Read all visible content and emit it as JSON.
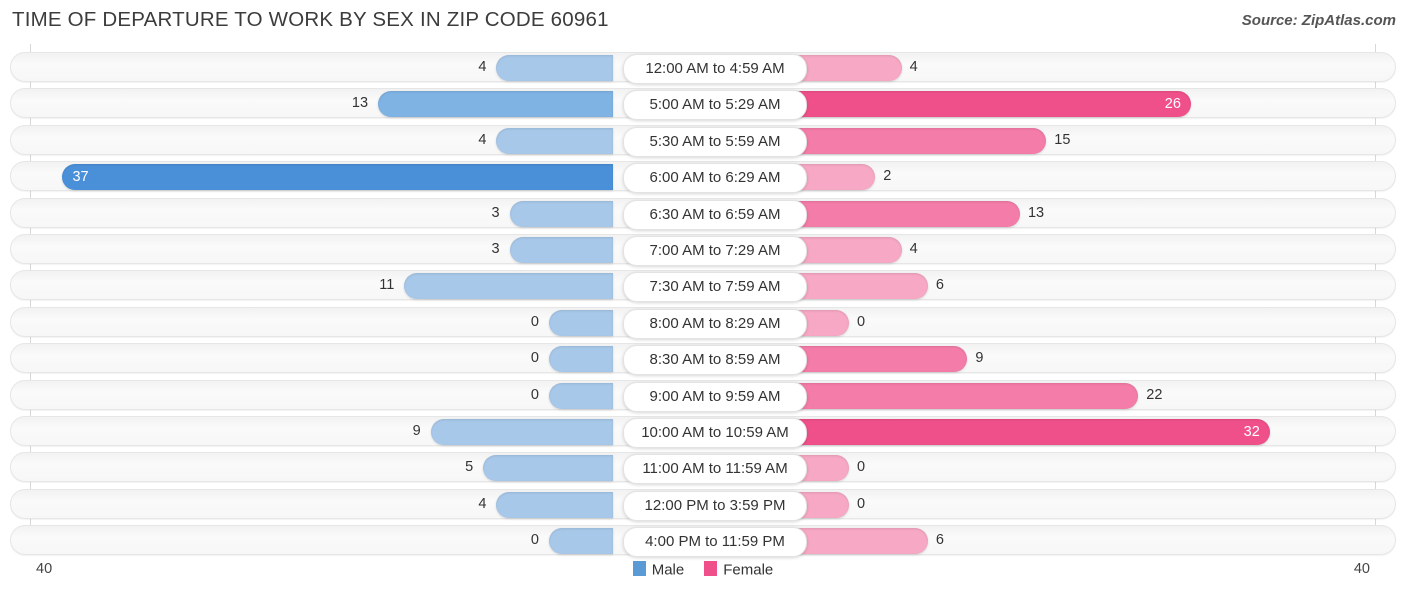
{
  "header": {
    "title": "TIME OF DEPARTURE TO WORK BY SEX IN ZIP CODE 60961",
    "source": "Source: ZipAtlas.com"
  },
  "legend": {
    "items": [
      {
        "label": "Male",
        "color": "#5b9bd5"
      },
      {
        "label": "Female",
        "color": "#f0508a"
      }
    ]
  },
  "axis": {
    "left_end_label": "40",
    "right_end_label": "40",
    "max": 40
  },
  "colors": {
    "male_dark": "#4a90d9",
    "male_mid": "#7fb3e3",
    "male_light": "#a8c8ea",
    "female_dark": "#f0508a",
    "female_mid": "#f47ca8",
    "female_light": "#f7a8c4",
    "row_background": "#f7f7f7",
    "text": "#333333"
  },
  "chart_data": {
    "type": "bar",
    "orientation": "horizontal-diverging",
    "title": "TIME OF DEPARTURE TO WORK BY SEX IN ZIP CODE 60961",
    "xlabel": "",
    "ylabel": "",
    "xlim": [
      40,
      40
    ],
    "grid": false,
    "legend_position": "bottom-center",
    "categories": [
      "12:00 AM to 4:59 AM",
      "5:00 AM to 5:29 AM",
      "5:30 AM to 5:59 AM",
      "6:00 AM to 6:29 AM",
      "6:30 AM to 6:59 AM",
      "7:00 AM to 7:29 AM",
      "7:30 AM to 7:59 AM",
      "8:00 AM to 8:29 AM",
      "8:30 AM to 8:59 AM",
      "9:00 AM to 9:59 AM",
      "10:00 AM to 10:59 AM",
      "11:00 AM to 11:59 AM",
      "12:00 PM to 3:59 PM",
      "4:00 PM to 11:59 PM"
    ],
    "series": [
      {
        "name": "Male",
        "values": [
          4,
          13,
          4,
          37,
          3,
          3,
          11,
          0,
          0,
          0,
          9,
          5,
          4,
          0
        ]
      },
      {
        "name": "Female",
        "values": [
          4,
          26,
          15,
          2,
          13,
          4,
          6,
          0,
          9,
          22,
          32,
          0,
          0,
          6
        ]
      }
    ]
  },
  "rows": [
    {
      "label": "12:00 AM to 4:59 AM",
      "male": "4",
      "female": "4"
    },
    {
      "label": "5:00 AM to 5:29 AM",
      "male": "13",
      "female": "26"
    },
    {
      "label": "5:30 AM to 5:59 AM",
      "male": "4",
      "female": "15"
    },
    {
      "label": "6:00 AM to 6:29 AM",
      "male": "37",
      "female": "2"
    },
    {
      "label": "6:30 AM to 6:59 AM",
      "male": "3",
      "female": "13"
    },
    {
      "label": "7:00 AM to 7:29 AM",
      "male": "3",
      "female": "4"
    },
    {
      "label": "7:30 AM to 7:59 AM",
      "male": "11",
      "female": "6"
    },
    {
      "label": "8:00 AM to 8:29 AM",
      "male": "0",
      "female": "0"
    },
    {
      "label": "8:30 AM to 8:59 AM",
      "male": "0",
      "female": "9"
    },
    {
      "label": "9:00 AM to 9:59 AM",
      "male": "0",
      "female": "22"
    },
    {
      "label": "10:00 AM to 10:59 AM",
      "male": "9",
      "female": "32"
    },
    {
      "label": "11:00 AM to 11:59 AM",
      "male": "5",
      "female": "0"
    },
    {
      "label": "12:00 PM to 3:59 PM",
      "male": "4",
      "female": "0"
    },
    {
      "label": "4:00 PM to 11:59 PM",
      "male": "0",
      "female": "6"
    }
  ]
}
